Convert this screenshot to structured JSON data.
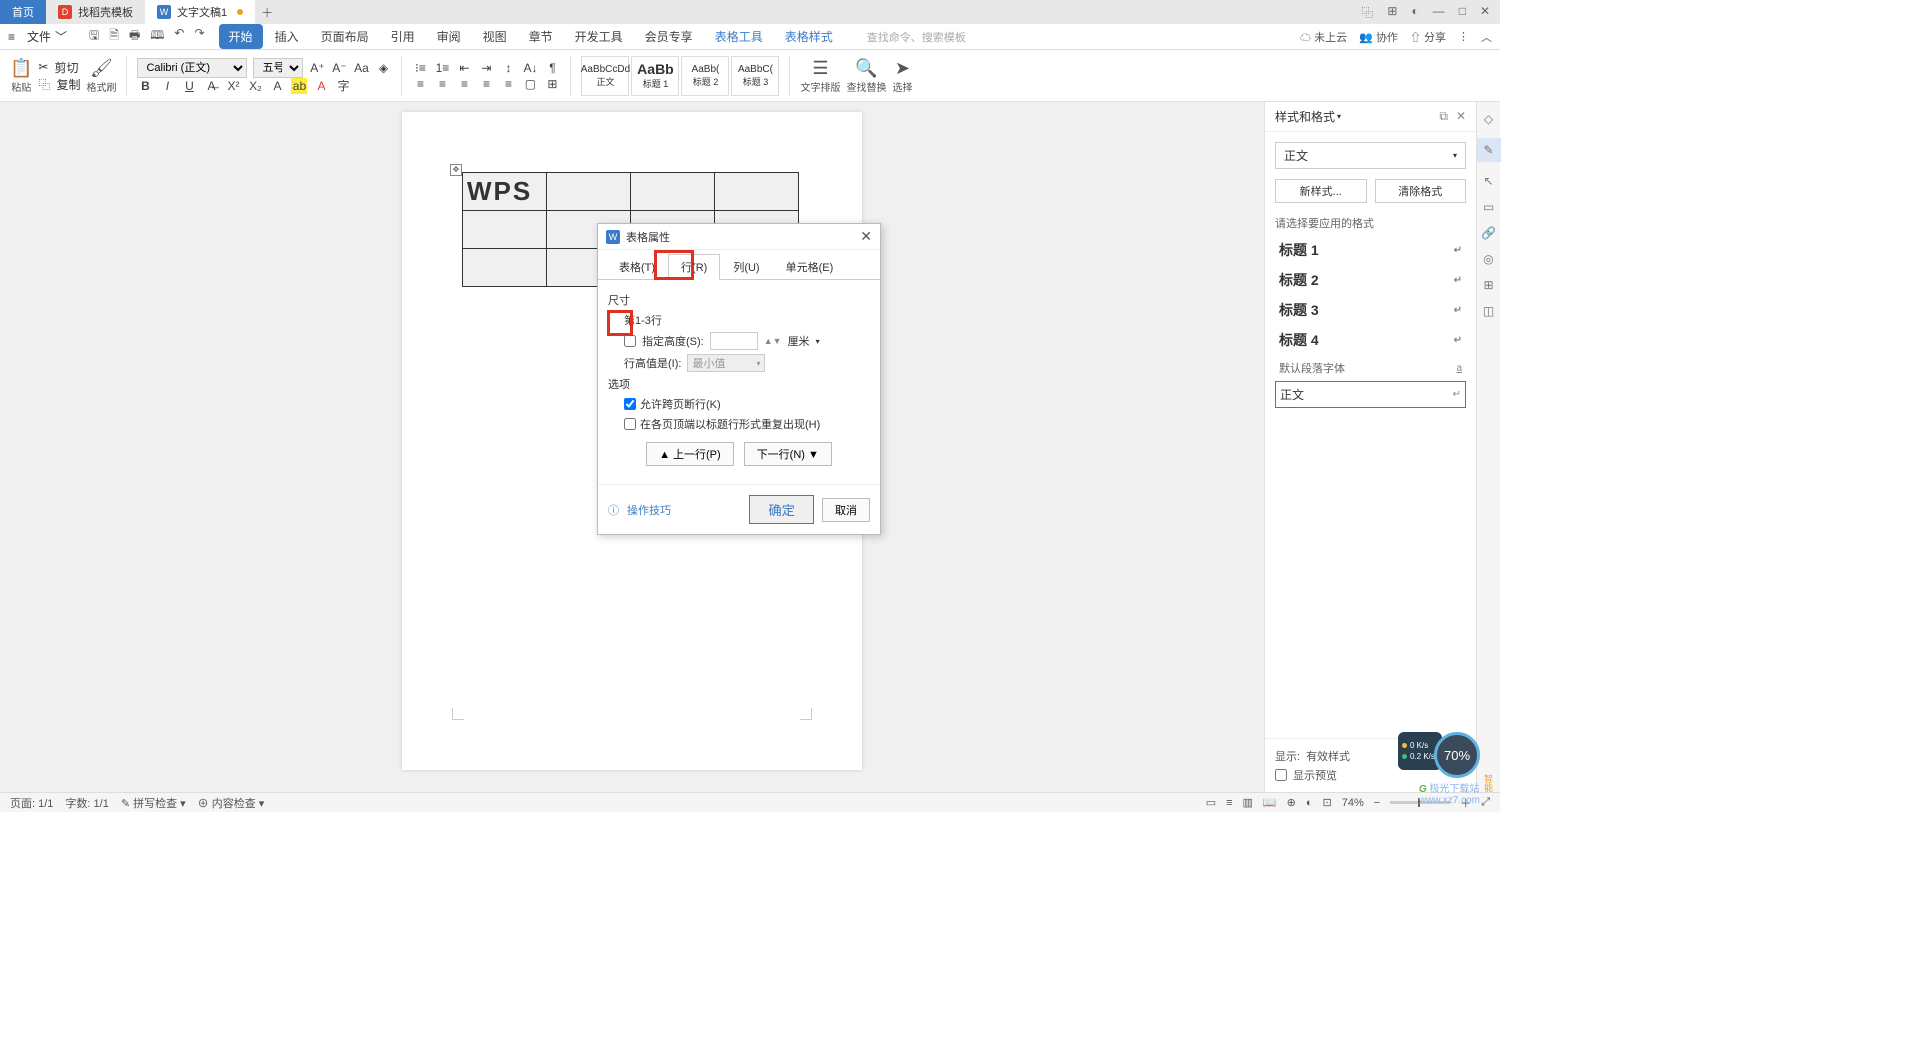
{
  "titlebar": {
    "tabs": [
      {
        "label": "首页",
        "kind": "home"
      },
      {
        "label": "找稻壳模板",
        "icon": "D"
      },
      {
        "label": "文字文稿1",
        "icon": "W",
        "unsaved": true
      }
    ],
    "win_icons": [
      "▭",
      "⊞",
      "◐",
      "—",
      "□",
      "✕"
    ]
  },
  "menubar": {
    "file": "文件",
    "items": [
      "开始",
      "插入",
      "页面布局",
      "引用",
      "审阅",
      "视图",
      "章节",
      "开发工具",
      "会员专享",
      "表格工具",
      "表格样式"
    ],
    "search_placeholder": "查找命令、搜索模板",
    "right": {
      "cloud": "未上云",
      "coop": "协作",
      "share": "分享"
    }
  },
  "ribbon": {
    "paste": "粘贴",
    "cut": "剪切",
    "copy": "复制",
    "format_painter": "格式刷",
    "font_name": "Calibri (正文)",
    "font_size": "五号",
    "styles": [
      {
        "preview": "AaBbCcDd",
        "label": "正文"
      },
      {
        "preview": "AaBb",
        "label": "标题 1"
      },
      {
        "preview": "AaBb(",
        "label": "标题 2"
      },
      {
        "preview": "AaBbC(",
        "label": "标题 3"
      }
    ],
    "text_layout": "文字排版",
    "find_replace": "查找替换",
    "select": "选择"
  },
  "document": {
    "cell_text": "WPS"
  },
  "dialog": {
    "title": "表格属性",
    "tabs": [
      "表格(T)",
      "行(R)",
      "列(U)",
      "单元格(E)"
    ],
    "active_tab": 1,
    "size_label": "尺寸",
    "row_range": "第1-3行",
    "spec_height": "指定高度(S):",
    "unit": "厘米",
    "row_height_is": "行高值是(I):",
    "row_height_val": "最小值",
    "options_label": "选项",
    "allow_break": "允许跨页断行(K)",
    "repeat_header": "在各页顶端以标题行形式重复出现(H)",
    "prev_row": "上一行(P)",
    "next_row": "下一行(N)",
    "tips": "操作技巧",
    "ok": "确定",
    "cancel": "取消"
  },
  "right_panel": {
    "title": "样式和格式",
    "current": "正文",
    "new_style": "新样式...",
    "clear": "清除格式",
    "hint": "请选择要应用的格式",
    "items": [
      "标题 1",
      "标题 2",
      "标题 3",
      "标题 4"
    ],
    "default_para": "默认段落字体",
    "selected": "正文",
    "show_label": "显示:",
    "show_value": "有效样式",
    "preview": "显示预览"
  },
  "statusbar": {
    "page": "页面: 1/1",
    "words": "字数: 1/1",
    "spell": "拼写检查",
    "content": "内容检查",
    "zoom": "74%"
  },
  "widgets": {
    "net_up": "0 K/s",
    "net_down": "0.2 K/s",
    "pct": "70%",
    "watermark_site": "极光下载站",
    "watermark_url": "www.xz7.com"
  }
}
